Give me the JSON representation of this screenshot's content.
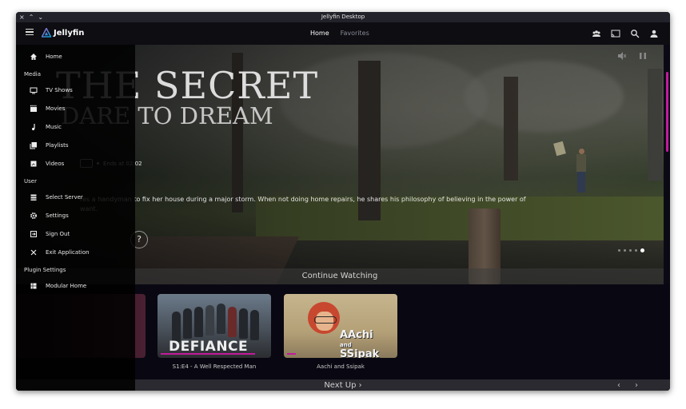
{
  "window": {
    "title": "Jellyfin Desktop",
    "controls": [
      "×",
      "⌃",
      "⌄"
    ]
  },
  "appbar": {
    "brand": "Jellyfin",
    "nav": [
      {
        "label": "Home"
      },
      {
        "label": "Favorites"
      }
    ],
    "icons": [
      "users-icon",
      "cast-icon",
      "search-icon",
      "user-icon"
    ]
  },
  "hero": {
    "logo_line1": "THE SECRET",
    "logo_line2": "DARE TO DREAM",
    "ends_at": "Ends at 02:02",
    "overview": "res a handyman to fix her house during a major storm. When not doing home repairs, he shares his philosophy of believing in the power of",
    "overview_line2": "want.",
    "button_glyph": "?"
  },
  "sidebar": {
    "home": "Home",
    "media_header": "Media",
    "media": [
      {
        "label": "TV Shows",
        "icon": "tv-icon"
      },
      {
        "label": "Movies",
        "icon": "movie-icon"
      },
      {
        "label": "Music",
        "icon": "music-icon"
      },
      {
        "label": "Playlists",
        "icon": "playlist-icon"
      },
      {
        "label": "Videos",
        "icon": "video-icon"
      }
    ],
    "user_header": "User",
    "user": [
      {
        "label": "Select Server",
        "icon": "server-icon"
      },
      {
        "label": "Settings",
        "icon": "gear-icon"
      },
      {
        "label": "Sign Out",
        "icon": "sign-out-icon"
      },
      {
        "label": "Exit Application",
        "icon": "close-icon"
      }
    ],
    "plugin_header": "Plugin Settings",
    "plugin": [
      {
        "label": "Modular Home",
        "icon": "grid-icon"
      }
    ]
  },
  "continue_watching": {
    "title": "Continue Watching",
    "items": [
      {
        "title": "S1:E4 - A Well Respected Man",
        "art_text": "DEFIANCE",
        "progress": 0.85
      },
      {
        "title": "Aachi and Ssipak",
        "art_text_1": "AAchi",
        "art_text_2": "and",
        "art_text_3": "SSipak",
        "progress": 0.08
      }
    ]
  },
  "next_up": {
    "title": "Next Up ›",
    "prev": "‹",
    "next": "›"
  },
  "colors": {
    "accent": "#c21b9b",
    "jellyfin_blue": "#00a4dc",
    "jellyfin_purple": "#aa5cc3"
  }
}
